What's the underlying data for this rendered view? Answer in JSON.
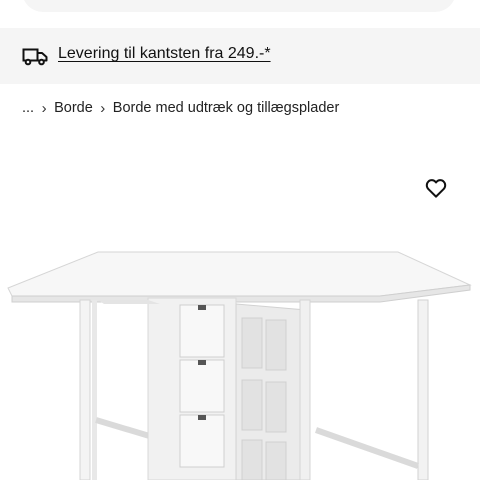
{
  "delivery": {
    "text": "Levering til kantsten fra 249.-*",
    "icon": "truck-icon"
  },
  "breadcrumb": {
    "items": [
      {
        "label": "..."
      },
      {
        "label": "Borde"
      },
      {
        "label": "Borde med udtræk og tillægsplader"
      }
    ],
    "separator": "›"
  },
  "product": {
    "favorite_icon": "heart-outline-icon",
    "image_subject": "white gateleg table with drawers"
  },
  "colors": {
    "bar_bg": "#f5f5f5",
    "text": "#111111"
  }
}
